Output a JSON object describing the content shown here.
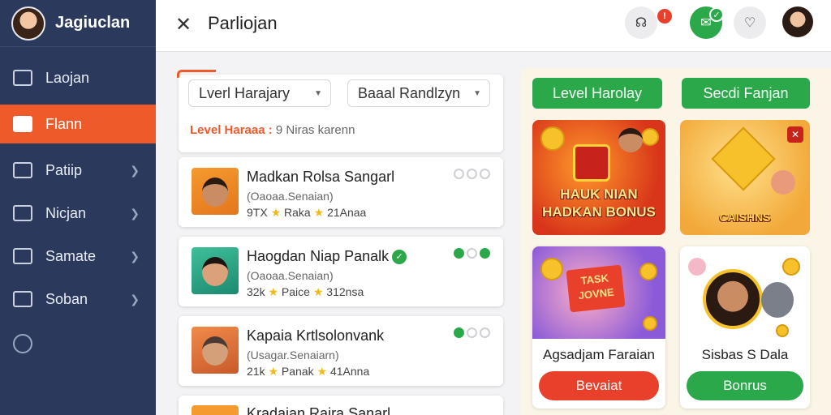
{
  "sidebar": {
    "title": "Jagiuclan",
    "items": [
      {
        "label": "Laojan",
        "active": false,
        "chevron": false
      },
      {
        "label": "Flann",
        "active": true,
        "chevron": false
      },
      {
        "label": "Patiip",
        "active": false,
        "chevron": true
      },
      {
        "label": "Nicjan",
        "active": false,
        "chevron": true
      },
      {
        "label": "Samate",
        "active": false,
        "chevron": true
      },
      {
        "label": "Soban",
        "active": false,
        "chevron": true
      }
    ]
  },
  "topbar": {
    "title": "Parliojan",
    "notification_badge": "!"
  },
  "filters": {
    "dropdown1": "Lverl Harajary",
    "dropdown2": "Baaal Randlzyn",
    "level_label": "Level Haraaa :",
    "level_value": "9 Niras karenn"
  },
  "list": [
    {
      "name": "Madkan Rolsa Sangarl",
      "sub": "(Oaoaa.Senaian)",
      "stat1": "9TX",
      "stat2": "Raka",
      "stat3": "21Anaa",
      "verified": false,
      "dots": [
        false,
        false,
        false
      ]
    },
    {
      "name": "Haogdan Niap Panalk",
      "sub": "(Oaoaa.Senaian)",
      "stat1": "32k",
      "stat2": "Paice",
      "stat3": "312nsa",
      "verified": true,
      "dots": [
        true,
        false,
        true
      ]
    },
    {
      "name": "Kapaia Krtlsolonvank",
      "sub": "(Usagar.Senaiarn)",
      "stat1": "21k",
      "stat2": "Panak",
      "stat3": "41Anna",
      "verified": false,
      "dots": [
        true,
        false,
        false
      ]
    },
    {
      "name": "Kradaian Raira Sanarl",
      "sub": "",
      "stat1": "",
      "stat2": "",
      "stat3": "",
      "verified": false,
      "dots": []
    }
  ],
  "right": {
    "btn1": "Level Harolay",
    "btn2": "Secdi Fanjan",
    "promo1_line1": "HAUK NIAN",
    "promo1_line2": "HADKAN BONUS",
    "promo2": "CAISHNS",
    "card1_caption": "Agsadjam Faraian",
    "card1_button": "Bevaiat",
    "card2_caption": "Sisbas S Dala",
    "card2_button": "Bonrus",
    "promo3_line1": "TASK",
    "promo3_line2": "JOVNE"
  },
  "colors": {
    "sidebar": "#2b3a5c",
    "accent": "#ef5a2b",
    "green": "#2aa84a",
    "red": "#e8402a"
  },
  "icons": [
    "close-icon",
    "headset-icon",
    "chat-icon",
    "heart-icon",
    "chevron-right-icon",
    "clock-icon",
    "star-icon",
    "check-icon"
  ]
}
